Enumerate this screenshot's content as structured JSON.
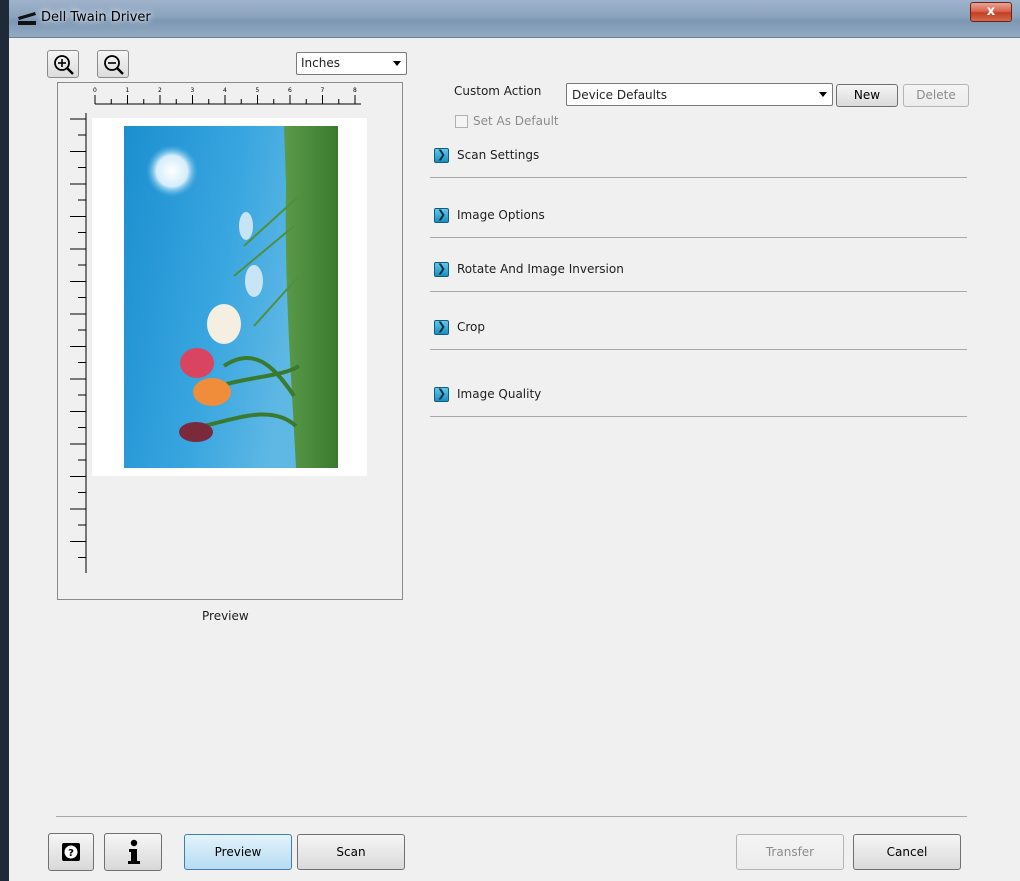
{
  "window": {
    "title": "Dell Twain Driver",
    "close_glyph": "x"
  },
  "preview": {
    "units_selected": "Inches",
    "ruler_ticks": [
      "0",
      "1",
      "2",
      "3",
      "4",
      "5",
      "6",
      "7",
      "8"
    ],
    "label": "Preview"
  },
  "custom_action": {
    "label": "Custom Action",
    "selected": "Device Defaults",
    "new_label": "New",
    "delete_label": "Delete",
    "set_default_label": "Set As Default",
    "set_default_checked": false
  },
  "sections": [
    {
      "label": "Scan Settings"
    },
    {
      "label": "Image Options"
    },
    {
      "label": "Rotate And Image Inversion"
    },
    {
      "label": "Crop"
    },
    {
      "label": "Image Quality"
    }
  ],
  "footer": {
    "preview_label": "Preview",
    "scan_label": "Scan",
    "transfer_label": "Transfer",
    "cancel_label": "Cancel"
  },
  "colors": {
    "section_icon": "#1c8fbf",
    "preview_button": "#b6dcf2",
    "sky": "#1b8fcf",
    "grass": "#4a8b3a"
  }
}
